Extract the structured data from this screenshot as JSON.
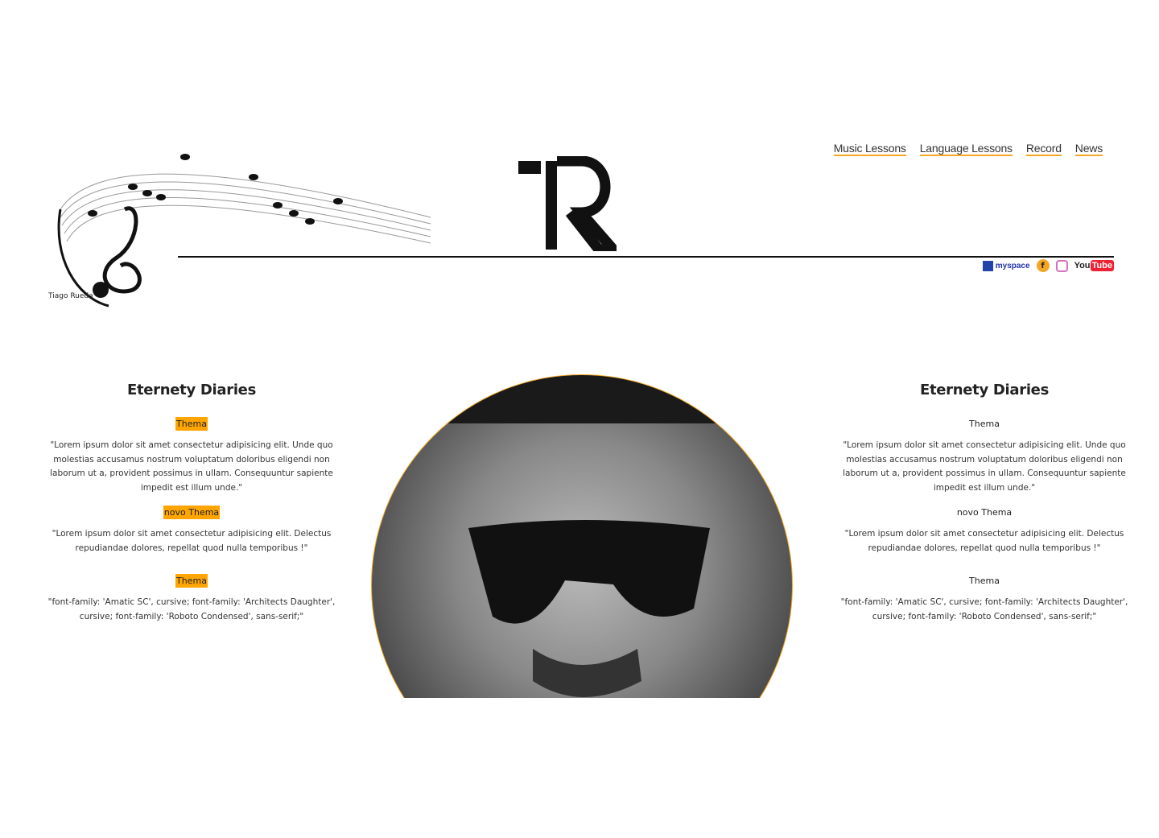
{
  "header": {
    "logo_text": "TR",
    "signature": "Tiago Rueda",
    "nav": [
      {
        "label": "Music Lessons"
      },
      {
        "label": "Language Lessons"
      },
      {
        "label": "Record"
      },
      {
        "label": "News"
      }
    ],
    "social": {
      "myspace": "myspace",
      "facebook": "f",
      "youtube_a": "You",
      "youtube_b": "Tube"
    }
  },
  "left": {
    "title": "Eternety Diaries",
    "sections": [
      {
        "tag": "Thema",
        "text": "\"Lorem ipsum dolor sit amet consectetur adipisicing elit. Unde quo molestias accusamus nostrum voluptatum doloribus eligendi non laborum ut a, provident possimus in ullam. Consequuntur sapiente impedit est illum unde.\""
      },
      {
        "tag": "novo Thema",
        "text": "\"Lorem ipsum dolor sit amet consectetur adipisicing elit. Delectus repudiandae dolores, repellat quod nulla temporibus !\""
      },
      {
        "tag": "Thema",
        "text": "\"font-family: 'Amatic SC', cursive; font-family: 'Architects Daughter', cursive; font-family: 'Roboto Condensed', sans-serif;\""
      }
    ]
  },
  "right": {
    "title": "Eternety Diaries",
    "sections": [
      {
        "tag": "Thema",
        "text": "\"Lorem ipsum dolor sit amet consectetur adipisicing elit. Unde quo molestias accusamus nostrum voluptatum doloribus eligendi non laborum ut a, provident possimus in ullam. Consequuntur sapiente impedit est illum unde.\""
      },
      {
        "tag": "novo Thema",
        "text": "\"Lorem ipsum dolor sit amet consectetur adipisicing elit. Delectus repudiandae dolores, repellat quod nulla temporibus !\""
      },
      {
        "tag": "Thema",
        "text": "\"font-family: 'Amatic SC', cursive; font-family: 'Architects Daughter', cursive; font-family: 'Roboto Condensed', sans-serif;\""
      }
    ]
  },
  "colors": {
    "accent": "#ffa500"
  }
}
